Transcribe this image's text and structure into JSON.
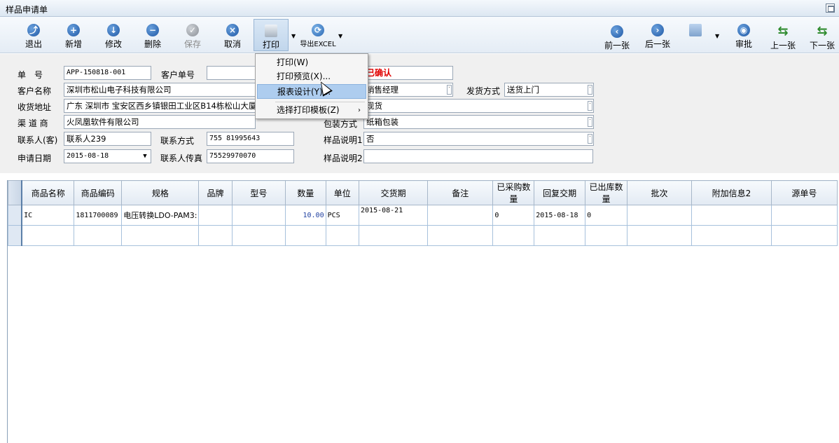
{
  "window": {
    "title": "样品申请单"
  },
  "toolbar": {
    "exit": "退出",
    "add": "新增",
    "edit": "修改",
    "delete": "删除",
    "save": "保存",
    "cancel": "取消",
    "print": "打印",
    "export": "导出EXCEL",
    "prev": "前一张",
    "next": "后一张",
    "approve": "审批",
    "up": "上一张",
    "down": "下一张"
  },
  "print_menu": {
    "items": [
      "打印(W)",
      "打印预览(X)...",
      "报表设计(Y)...",
      "选择打印模板(Z)"
    ],
    "highlighted": "报表设计(Y)..."
  },
  "form": {
    "order_no_label": "单　号",
    "order_no": "APP-150818-001",
    "customer_no_label": "客户单号",
    "customer_no": "",
    "status": "已确认",
    "customer_name_label": "客户名称",
    "customer_name": "深圳市松山电子科技有限公司",
    "salesperson": "销售经理",
    "ship_method_label": "发货方式",
    "ship_method": "送货上门",
    "address_label": "收货地址",
    "address": "广东 深圳市 宝安区西乡镇银田工业区B14栋松山大厦",
    "ship_type": "现货",
    "channel_label": "渠 道 商",
    "channel": "火凤凰软件有限公司",
    "package_label": "包装方式",
    "package": "纸箱包装",
    "contact_label": "联系人(客)",
    "contact": "联系人239",
    "contact_phone_label": "联系方式",
    "contact_phone": "755 81995643",
    "sample_desc1_label": "样品说明1",
    "sample_desc1": "否",
    "apply_date_label": "申请日期",
    "apply_date": "2015-08-18",
    "contact_fax_label": "联系人传真",
    "contact_fax": "75529970070",
    "sample_desc2_label": "样品说明2",
    "sample_desc2": ""
  },
  "grid": {
    "columns": [
      "商品名称",
      "商品编码",
      "规格",
      "品牌",
      "型号",
      "数量",
      "单位",
      "交货期",
      "备注",
      "已采购数量",
      "回复交期",
      "已出库数量",
      "批次",
      "附加信息2",
      "源单号"
    ],
    "rows": [
      {
        "name": "IC",
        "code": "1811700089",
        "spec": "电压转换LDO-PAM3:",
        "brand": "",
        "model": "",
        "qty": "10.00",
        "unit": "PCS",
        "delivery": "2015-08-21",
        "remark": "",
        "purchased": "0",
        "reply_date": "2015-08-18",
        "shipped": "0",
        "batch": "",
        "extra2": "",
        "source": ""
      }
    ]
  }
}
